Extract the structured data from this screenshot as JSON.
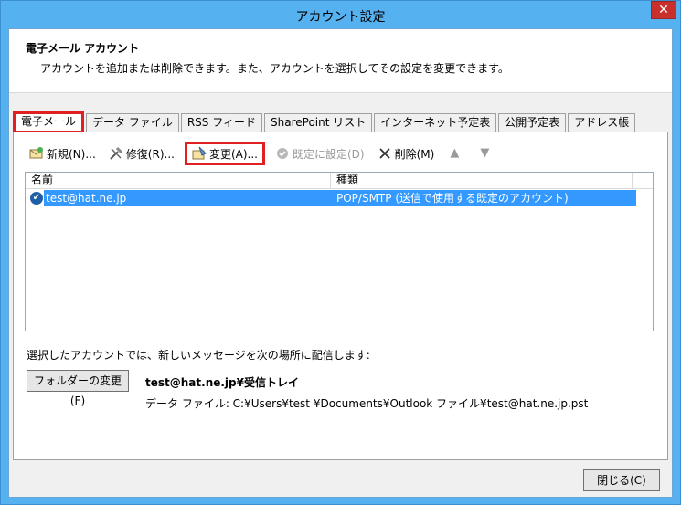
{
  "window": {
    "title": "アカウント設定",
    "close_glyph": "✕"
  },
  "header": {
    "title": "電子メール アカウント",
    "description": "アカウントを追加または削除できます。また、アカウントを選択してその設定を変更できます。"
  },
  "tabs": [
    {
      "label": "電子メール"
    },
    {
      "label": "データ ファイル"
    },
    {
      "label": "RSS フィード"
    },
    {
      "label": "SharePoint リスト"
    },
    {
      "label": "インターネット予定表"
    },
    {
      "label": "公開予定表"
    },
    {
      "label": "アドレス帳"
    }
  ],
  "toolbar": {
    "new_label": "新規(N)...",
    "repair_label": "修復(R)...",
    "change_label": "変更(A)...",
    "default_label": "既定に設定(D)",
    "delete_label": "削除(M)",
    "up_glyph": "▲",
    "down_glyph": "▼",
    "icons": {
      "new": "envelope-icon",
      "repair": "tools-icon",
      "change": "change-icon",
      "default": "check-circle-icon",
      "delete": "x-icon"
    }
  },
  "list": {
    "columns": {
      "name": "名前",
      "type": "種類"
    },
    "rows": [
      {
        "name": "test@hat.ne.jp",
        "type": "POP/SMTP (送信で使用する既定のアカウント)"
      }
    ]
  },
  "delivery": {
    "label": "選択したアカウントでは、新しいメッセージを次の場所に配信します:",
    "folder_button": "フォルダーの変更(F)",
    "target": "test@hat.ne.jp¥受信トレイ",
    "data_file": "データ ファイル: C:¥Users¥test ¥Documents¥Outlook ファイル¥test@hat.ne.jp.pst"
  },
  "footer": {
    "close_label": "閉じる(C)"
  },
  "colors": {
    "accent": "#3399ff",
    "highlight": "#e02020",
    "titlebar": "#56b1f0"
  }
}
